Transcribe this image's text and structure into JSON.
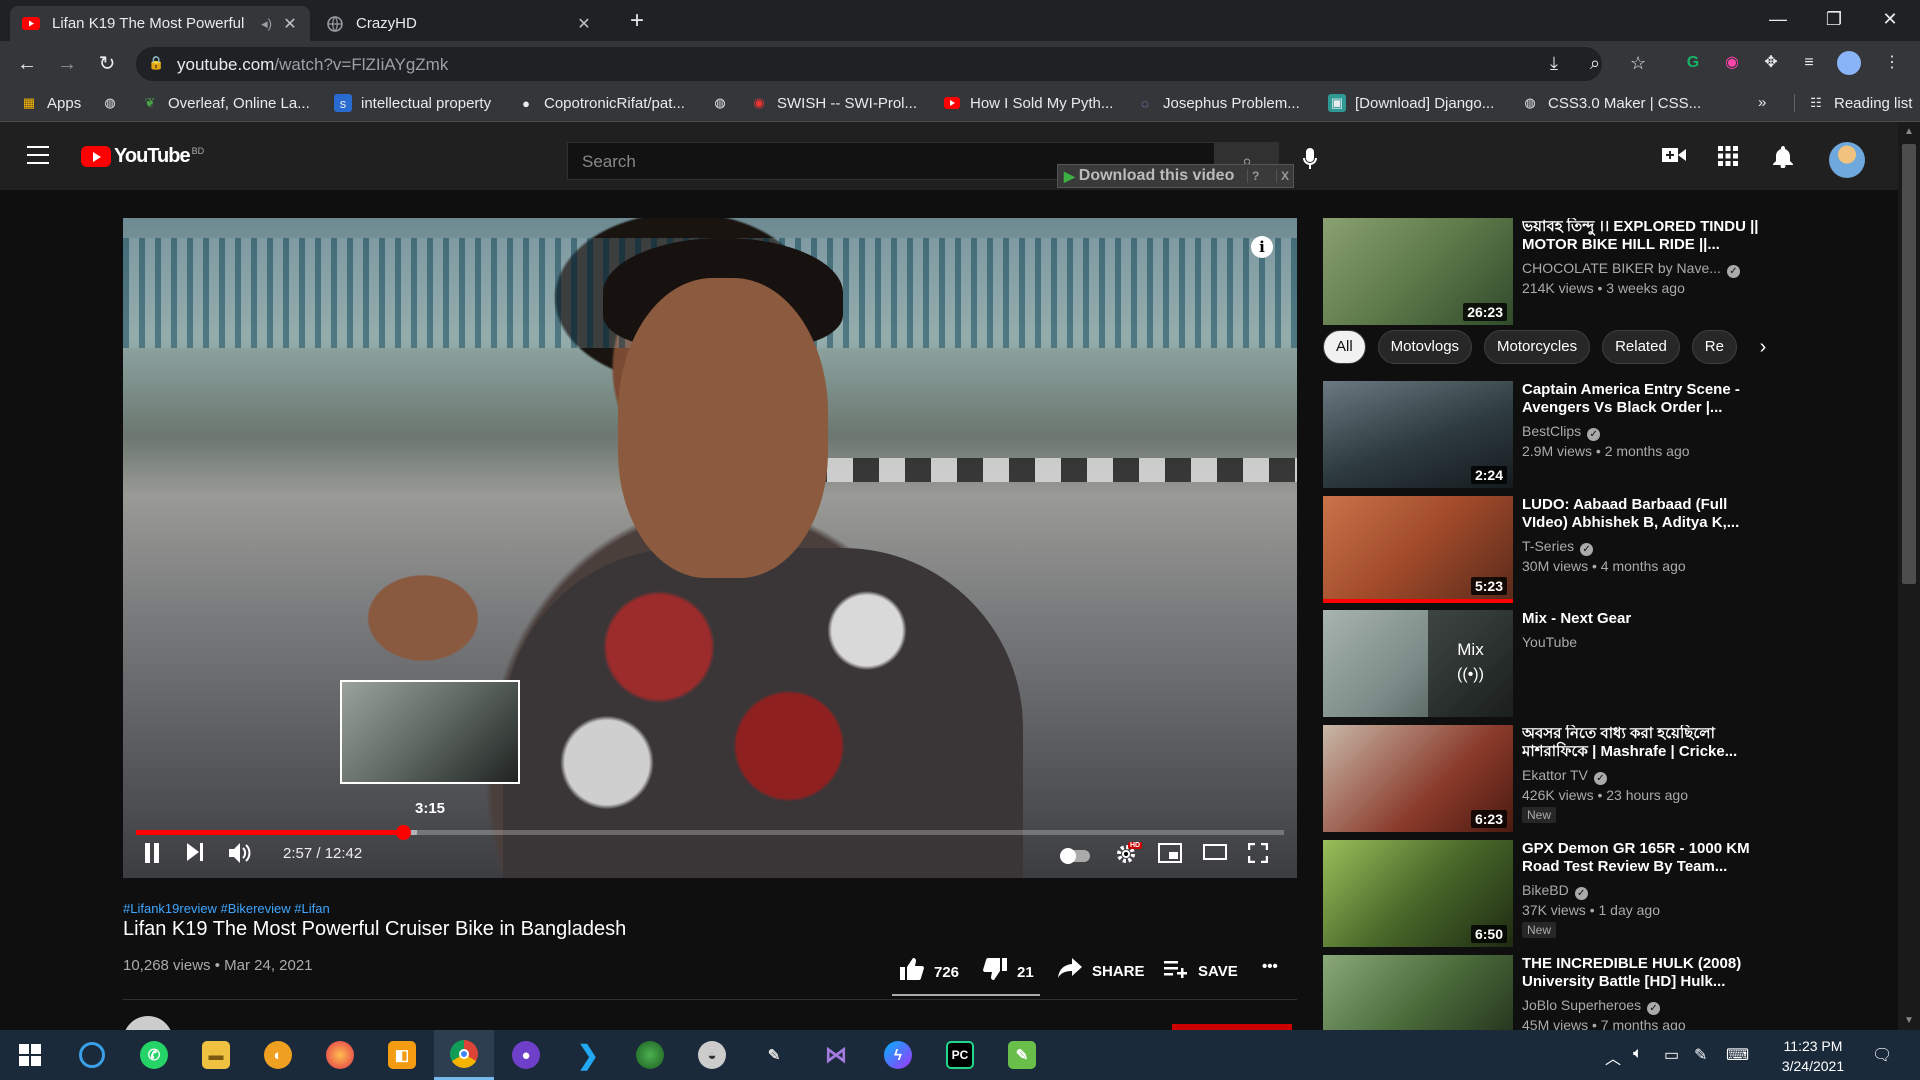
{
  "browser": {
    "tabs": [
      {
        "title": "Lifan K19 The Most Powerful",
        "active": true
      },
      {
        "title": "CrazyHD",
        "active": false
      }
    ],
    "url_host": "youtube.com",
    "url_path": "/watch?v=FlZIiAYgZmk",
    "bookmarks": [
      {
        "label": "Apps",
        "icon": "apps-grid-icon"
      },
      {
        "label": "",
        "icon": "globe-icon"
      },
      {
        "label": "Overleaf, Online La...",
        "icon": "overleaf-icon"
      },
      {
        "label": "intellectual property",
        "icon": "s-icon"
      },
      {
        "label": "CopotronicRifat/pat...",
        "icon": "github-icon"
      },
      {
        "label": "",
        "icon": "globe-icon"
      },
      {
        "label": "SWISH -- SWI-Prol...",
        "icon": "swish-icon"
      },
      {
        "label": "How I Sold My Pyth...",
        "icon": "youtube-icon"
      },
      {
        "label": "Josephus Problem...",
        "icon": "loading-icon"
      },
      {
        "label": "[Download] Django...",
        "icon": "django-icon"
      },
      {
        "label": "CSS3.0 Maker | CSS...",
        "icon": "globe-icon"
      }
    ],
    "bookmarks_overflow": "»",
    "reading_list": "Reading list"
  },
  "youtube": {
    "logo_text": "YouTube",
    "country_code": "BD",
    "search_placeholder": "Search",
    "download_button": "Download this video",
    "download_help": "?",
    "download_close": "X",
    "player": {
      "preview_time": "3:15",
      "current_time": "2:57",
      "duration": "12:42",
      "time_display": "2:57 / 12:42",
      "progress_fraction": 0.233,
      "buffered_fraction": 0.245,
      "hd_badge": "HD"
    },
    "hashtags": "#Lifank19review #Bikereview #Lifan",
    "video_title": "Lifan K19 The Most Powerful Cruiser Bike in Bangladesh",
    "views": "10,268 views",
    "date": "Mar 24, 2021",
    "meta_line": "10,268 views • Mar 24, 2021",
    "likes": "726",
    "dislikes": "21",
    "like_ratio": 0.972,
    "share_label": "SHARE",
    "save_label": "SAVE",
    "more_label": "•••",
    "chips": [
      "All",
      "Motovlogs",
      "Motorcycles",
      "Related",
      "Re"
    ],
    "sidebar": [
      {
        "title": "ভয়াবহ তিন্দু ।। EXPLORED TINDU || MOTOR BIKE HILL RIDE ||...",
        "channel": "CHOCOLATE BIKER by Nave...",
        "verified": true,
        "meta": "214K views • 3 weeks ago",
        "duration": "26:23",
        "badge": "",
        "thumb_color": "#6f8a5a"
      },
      {
        "title": "Captain America Entry Scene - Avengers Vs Black Order |...",
        "channel": "BestClips",
        "verified": true,
        "meta": "2.9M views • 2 months ago",
        "duration": "2:24",
        "badge": "",
        "thumb_color": "#2d3a40"
      },
      {
        "title": "LUDO: Aabaad Barbaad (Full VIdeo) Abhishek B, Aditya K,...",
        "channel": "T-Series",
        "verified": true,
        "meta": "30M views • 4 months ago",
        "duration": "5:23",
        "badge": "",
        "thumb_color": "#a04a2a"
      },
      {
        "title": "Mix - Next Gear",
        "channel": "YouTube",
        "verified": false,
        "meta": "",
        "duration": "",
        "badge": "",
        "thumb_color": "#7a8a86",
        "mix_label": "Mix"
      },
      {
        "title": "অবসর নিতে বাধ্য করা হয়েছিলো মাশরাফিকে | Mashrafe | Cricke...",
        "channel": "Ekattor TV",
        "verified": true,
        "meta": "426K views • 23 hours ago",
        "duration": "6:23",
        "badge": "New",
        "thumb_color": "#8a3a2a"
      },
      {
        "title": "GPX Demon GR 165R - 1000 KM Road Test Review By Team...",
        "channel": "BikeBD",
        "verified": true,
        "meta": "37K views • 1 day ago",
        "duration": "6:50",
        "badge": "New",
        "thumb_color": "#4a6a2a"
      },
      {
        "title": "THE INCREDIBLE HULK (2008) University Battle [HD] Hulk...",
        "channel": "JoBlo Superheroes",
        "verified": true,
        "meta": "45M views • 7 months ago",
        "duration": "",
        "badge": "",
        "thumb_color": "#4a6a3a"
      }
    ]
  },
  "taskbar": {
    "apps": [
      "windows-start",
      "search",
      "whatsapp",
      "file-explorer",
      "bitwarden",
      "firefox",
      "office",
      "chrome",
      "github-desktop",
      "vscode",
      "network-app",
      "satellite-app",
      "idea-app",
      "visual-studio",
      "messenger",
      "pycharm",
      "notepad"
    ],
    "pycharm_label": "PC",
    "time": "11:23 PM",
    "date": "3/24/2021"
  }
}
